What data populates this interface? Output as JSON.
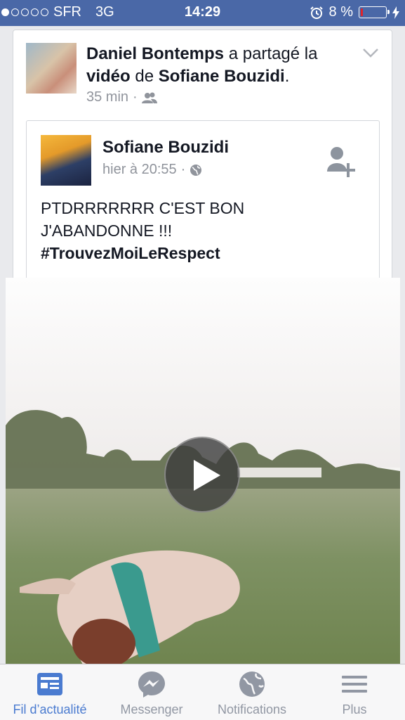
{
  "status_bar": {
    "carrier": "SFR",
    "network": "3G",
    "time": "14:29",
    "battery_percent": "8 %",
    "battery_level": 0.08,
    "signal_bars_filled": 1,
    "signal_bars_total": 5
  },
  "share_header": {
    "sharer_name": "Daniel Bontemps",
    "action_text": " a partagé la ",
    "object_word": "vidéo",
    "preposition": " de ",
    "author_name": "Sofiane Bouzidi",
    "trailing": ".",
    "time_ago": "35 min",
    "separator": "·",
    "audience_icon": "friends-icon"
  },
  "original_post": {
    "author_name": "Sofiane Bouzidi",
    "timestamp": "hier à 20:55",
    "separator": "·",
    "audience_icon": "globe-icon",
    "text_line1": "PTDRRRRRRR C'EST BON",
    "text_line2": "J'ABANDONNE !!!",
    "hashtag": "#TrouvezMoiLeRespect"
  },
  "video": {
    "play_icon": "play-icon"
  },
  "tab_bar": {
    "tabs": [
      {
        "label": "Fil d’actualité",
        "icon": "news-feed-icon",
        "active": true
      },
      {
        "label": "Messenger",
        "icon": "messenger-icon",
        "active": false
      },
      {
        "label": "Notifications",
        "icon": "globe-icon",
        "active": false
      },
      {
        "label": "Plus",
        "icon": "menu-icon",
        "active": false
      }
    ]
  },
  "colors": {
    "status_bar_bg": "#4a68a7",
    "active_tab": "#4a7bd0",
    "inactive_tab": "#9197a3",
    "battery_low": "#e0242b"
  }
}
